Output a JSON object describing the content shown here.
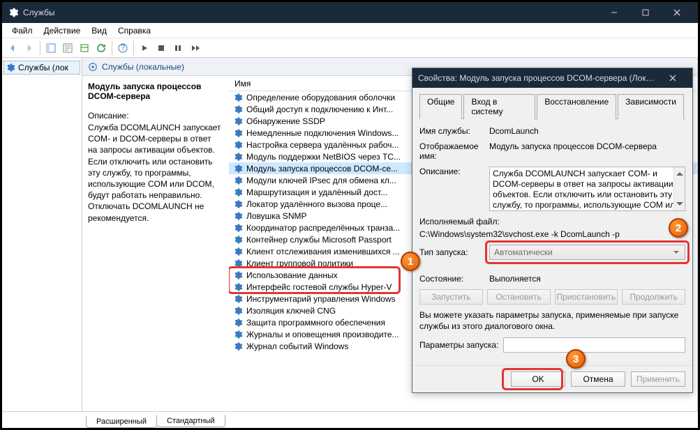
{
  "window": {
    "title": "Службы"
  },
  "menu": {
    "file": "Файл",
    "action": "Действие",
    "view": "Вид",
    "help": "Справка"
  },
  "tree": {
    "root": "Службы (лок"
  },
  "center": {
    "header": "Службы (локальные)",
    "selected_name": "Модуль запуска процессов DCOM-сервера",
    "desc_label": "Описание:",
    "desc": "Служба DCOMLAUNCH запускает COM- и DCOM-серверы в ответ на запросы активации объектов. Если отключить или остановить эту службу, то программы, использующие COM или DCOM, будут работать неправильно. Отключать DCOMLAUNCH не рекомендуется.",
    "col": "Имя"
  },
  "services": [
    "Журнал событий Windows",
    "Журналы и оповещения производите...",
    "Защита программного обеспечения",
    "Изоляция ключей CNG",
    "Инструментарий управления Windows",
    "Интерфейс гостевой службы Hyper-V",
    "Использование данных",
    "Клиент групповой политики",
    "Клиент отслеживания изменившихся ...",
    "Контейнер службы Microsoft Passport",
    "Координатор распределённых транза...",
    "Ловушка SNMP",
    "Локатор удалённого вызова проце...",
    "Маршрутизация и удалённый дост...",
    "Модули ключей IPsec для обмена кл...",
    "Модуль запуска процессов DCOM-се...",
    "Модуль поддержки NetBIOS через TC...",
    "Настройка сервера удалённых рабоч...",
    "Немедленные подключения Windows...",
    "Обнаружение SSDP",
    "Общий доступ к подключению к Инт...",
    "Определение оборудования оболочки"
  ],
  "footer": {
    "tab1": "Расширенный",
    "tab2": "Стандартный"
  },
  "dialog": {
    "title": "Свойства: Модуль запуска процессов DCOM-сервера (Локальн...",
    "tabs": {
      "general": "Общие",
      "logon": "Вход в систему",
      "recovery": "Восстановление",
      "deps": "Зависимости"
    },
    "svc_name_lbl": "Имя службы:",
    "svc_name": "DcomLaunch",
    "disp_name_lbl": "Отображаемое имя:",
    "disp_name": "Модуль запуска процессов DCOM-сервера",
    "desc_lbl": "Описание:",
    "desc": "Служба DCOMLAUNCH запускает COM- и DCOM-серверы в ответ на запросы активации объектов. Если отключить или остановить эту службу, то программы, использующие COM или",
    "exe_lbl": "Исполняемый файл:",
    "exe": "C:\\Windows\\system32\\svchost.exe -k DcomLaunch -p",
    "start_lbl": "Тип запуска:",
    "start_val": "Автоматически",
    "state_lbl": "Состояние:",
    "state_val": "Выполняется",
    "btn_start": "Запустить",
    "btn_stop": "Остановить",
    "btn_pause": "Приостановить",
    "btn_resume": "Продолжить",
    "hint": "Вы можете указать параметры запуска, применяемые при запуске службы из этого диалогового окна.",
    "params_lbl": "Параметры запуска:",
    "ok": "OK",
    "cancel": "Отмена",
    "apply": "Применить"
  },
  "badges": {
    "b1": "1",
    "b2": "2",
    "b3": "3"
  }
}
